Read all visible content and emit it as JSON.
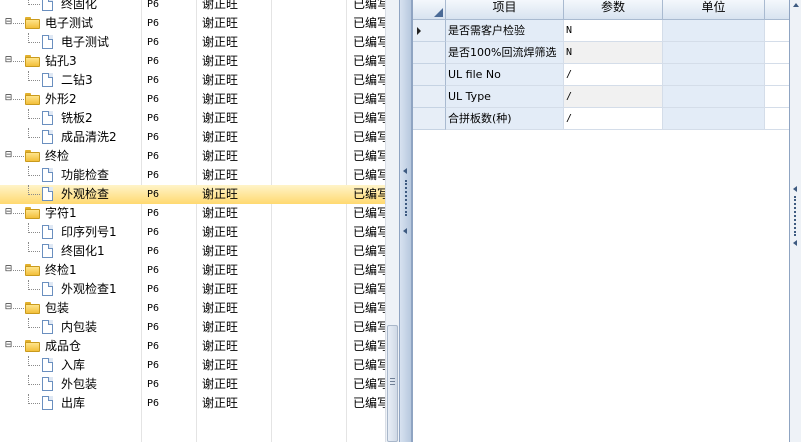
{
  "tree": {
    "rows": [
      {
        "name": "终固化",
        "code": "P6",
        "person": "谢正旺",
        "status": "已编写",
        "level": 1,
        "type": "doc"
      },
      {
        "name": "电子测试",
        "code": "P6",
        "person": "谢正旺",
        "status": "已编写",
        "level": 0,
        "type": "folder"
      },
      {
        "name": "电子测试",
        "code": "P6",
        "person": "谢正旺",
        "status": "已编写",
        "level": 1,
        "type": "doc"
      },
      {
        "name": "钻孔3",
        "code": "P6",
        "person": "谢正旺",
        "status": "已编写",
        "level": 0,
        "type": "folder"
      },
      {
        "name": "二钻3",
        "code": "P6",
        "person": "谢正旺",
        "status": "已编写",
        "level": 1,
        "type": "doc"
      },
      {
        "name": "外形2",
        "code": "P6",
        "person": "谢正旺",
        "status": "已编写",
        "level": 0,
        "type": "folder"
      },
      {
        "name": "铣板2",
        "code": "P6",
        "person": "谢正旺",
        "status": "已编写",
        "level": 1,
        "type": "doc"
      },
      {
        "name": "成品清洗2",
        "code": "P6",
        "person": "谢正旺",
        "status": "已编写",
        "level": 1,
        "type": "doc"
      },
      {
        "name": "终检",
        "code": "P6",
        "person": "谢正旺",
        "status": "已编写",
        "level": 0,
        "type": "folder"
      },
      {
        "name": "功能检查",
        "code": "P6",
        "person": "谢正旺",
        "status": "已编写",
        "level": 1,
        "type": "doc"
      },
      {
        "name": "外观检查",
        "code": "P6",
        "person": "谢正旺",
        "status": "已编写",
        "level": 1,
        "type": "doc",
        "selected": true
      },
      {
        "name": "字符1",
        "code": "P6",
        "person": "谢正旺",
        "status": "已编写",
        "level": 0,
        "type": "folder"
      },
      {
        "name": "印序列号1",
        "code": "P6",
        "person": "谢正旺",
        "status": "已编写",
        "level": 1,
        "type": "doc"
      },
      {
        "name": "终固化1",
        "code": "P6",
        "person": "谢正旺",
        "status": "已编写",
        "level": 1,
        "type": "doc"
      },
      {
        "name": "终检1",
        "code": "P6",
        "person": "谢正旺",
        "status": "已编写",
        "level": 0,
        "type": "folder"
      },
      {
        "name": "外观检查1",
        "code": "P6",
        "person": "谢正旺",
        "status": "已编写",
        "level": 1,
        "type": "doc"
      },
      {
        "name": "包装",
        "code": "P6",
        "person": "谢正旺",
        "status": "已编写",
        "level": 0,
        "type": "folder"
      },
      {
        "name": "内包装",
        "code": "P6",
        "person": "谢正旺",
        "status": "已编写",
        "level": 1,
        "type": "doc"
      },
      {
        "name": "成品仓",
        "code": "P6",
        "person": "谢正旺",
        "status": "已编写",
        "level": 0,
        "type": "folder"
      },
      {
        "name": "入库",
        "code": "P6",
        "person": "谢正旺",
        "status": "已编写",
        "level": 1,
        "type": "doc"
      },
      {
        "name": "外包装",
        "code": "P6",
        "person": "谢正旺",
        "status": "已编写",
        "level": 1,
        "type": "doc"
      },
      {
        "name": "出库",
        "code": "P6",
        "person": "谢正旺",
        "status": "已编写",
        "level": 1,
        "type": "doc"
      }
    ]
  },
  "params_grid": {
    "headers": {
      "item": "项目",
      "value": "参数",
      "unit": "单位"
    },
    "rows": [
      {
        "item": "是否需客户检验",
        "value": "N",
        "unit": "",
        "current": true
      },
      {
        "item": "是否100%回流焊筛选",
        "value": "N",
        "unit": ""
      },
      {
        "item": "UL file No",
        "value": "/",
        "unit": ""
      },
      {
        "item": "UL Type",
        "value": "/",
        "unit": ""
      },
      {
        "item": "合拼板数(种)",
        "value": "/",
        "unit": ""
      }
    ]
  },
  "colors": {
    "selection": "#ffd970",
    "header": "#d8e3f0",
    "item_cell": "#e3ecf7",
    "folder": "#f2bf3a"
  }
}
